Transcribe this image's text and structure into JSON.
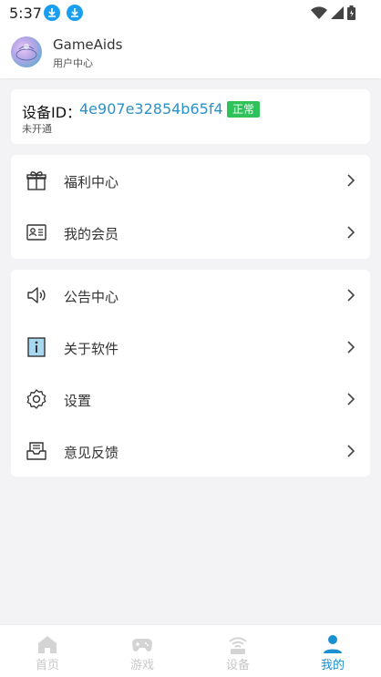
{
  "status_bar": {
    "time": "5:37"
  },
  "header": {
    "app_name": "GameAids",
    "subtitle": "用户中心"
  },
  "device": {
    "label": "设备ID：",
    "id": "4e907e32854b65f4",
    "badge": "正常",
    "status": "未开通"
  },
  "menu_group_1": [
    {
      "label": "福利中心",
      "icon": "gift-icon"
    },
    {
      "label": "我的会员",
      "icon": "member-card-icon"
    }
  ],
  "menu_group_2": [
    {
      "label": "公告中心",
      "icon": "speaker-icon"
    },
    {
      "label": "关于软件",
      "icon": "info-icon"
    },
    {
      "label": "设置",
      "icon": "gear-icon"
    },
    {
      "label": "意见反馈",
      "icon": "feedback-tray-icon"
    }
  ],
  "bottom_nav": [
    {
      "label": "首页",
      "icon": "home-icon",
      "active": false
    },
    {
      "label": "游戏",
      "icon": "gamepad-icon",
      "active": false
    },
    {
      "label": "设备",
      "icon": "device-icon",
      "active": false
    },
    {
      "label": "我的",
      "icon": "user-icon",
      "active": true
    }
  ],
  "colors": {
    "accent": "#1a8fd1",
    "badge_green": "#2fc25b",
    "device_id": "#2a92c7",
    "background": "#f3f3f5"
  }
}
